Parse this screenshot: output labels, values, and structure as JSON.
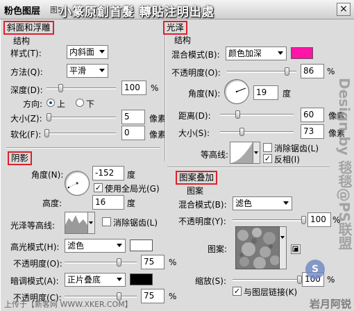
{
  "window": {
    "title": "粉色图层",
    "title_extra": "图5",
    "banner": "小篆原創首髮  轉貼注明出處",
    "close_label": "×"
  },
  "bevel": {
    "section_title": "斜面和浮雕",
    "group_label": "结构",
    "style_label": "样式(T):",
    "style_value": "内斜面",
    "method_label": "方法(Q):",
    "method_value": "平滑",
    "depth_label": "深度(D):",
    "depth_value": "100",
    "depth_unit": "%",
    "depth_level": 0.2,
    "direction_label": "方向:",
    "direction_up": "上",
    "direction_down": "下",
    "size_label": "大小(Z):",
    "size_value": "5",
    "size_unit": "像素",
    "size_level": 0.03,
    "soften_label": "软化(F):",
    "soften_value": "0",
    "soften_unit": "像素",
    "soften_level": 0.0
  },
  "shading": {
    "section_title": "阴影",
    "angle_label": "角度(N):",
    "angle_value": "-152",
    "angle_unit": "度",
    "global_light_label": "使用全局光(G)",
    "altitude_label": "高度:",
    "altitude_value": "16",
    "altitude_unit": "度",
    "gloss_label": "光泽等高线:",
    "antialias_label": "消除锯齿(L)",
    "highlight_mode_label": "高光模式(H):",
    "highlight_mode_value": "滤色",
    "highlight_color": "#ffffff",
    "highlight_opacity_label": "不透明度(O):",
    "highlight_opacity_value": "75",
    "highlight_opacity_level": 0.75,
    "shadow_mode_label": "暗调模式(A):",
    "shadow_mode_value": "正片叠底",
    "shadow_color": "#000000",
    "shadow_opacity_label": "不透明度(C):",
    "shadow_opacity_value": "75",
    "shadow_opacity_level": 0.75,
    "percent": "%"
  },
  "satin": {
    "section_title": "光泽",
    "group_label": "结构",
    "blend_label": "混合模式(B):",
    "blend_value": "颜色加深",
    "color": "#ff14a8",
    "opacity_label": "不透明度(O):",
    "opacity_value": "86",
    "opacity_unit": "%",
    "opacity_level": 0.86,
    "angle_label": "角度(N):",
    "angle_value": "19",
    "angle_unit": "度",
    "distance_label": "距离(D):",
    "distance_value": "60",
    "distance_unit": "像素",
    "distance_level": 0.24,
    "size_label": "大小(S):",
    "size_value": "73",
    "size_unit": "像素",
    "size_level": 0.29,
    "contour_label": "等高线:",
    "antialias_label": "消除锯齿(L)",
    "invert_label": "反相(I)"
  },
  "pattern": {
    "section_title": "图案叠加",
    "group_label": "图案",
    "blend_label": "混合模式(B):",
    "blend_value": "滤色",
    "opacity_label": "不透明度(Y):",
    "opacity_value": "100",
    "opacity_unit": "%",
    "opacity_level": 1.0,
    "pattern_label": "图案:",
    "scale_label": "缩放(S):",
    "scale_value": "100",
    "scale_unit": "%",
    "link_label": "与图层链接(K)"
  },
  "watermark": {
    "vertical": "Design by 毯毯@PS联盟",
    "site_mark": "S",
    "footer_left": "上传于【新客网 WWW.XKER.COM】",
    "footer_right": "岩月阿锐"
  }
}
